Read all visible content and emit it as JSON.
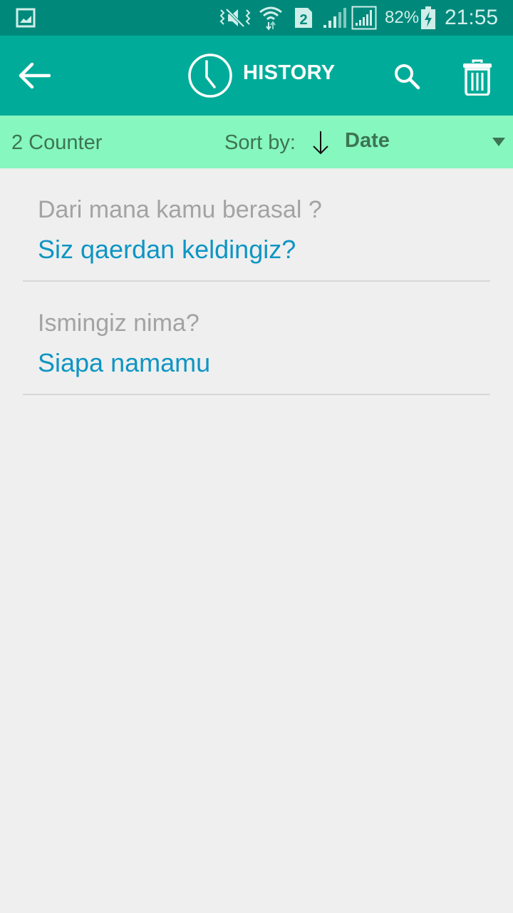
{
  "status_bar": {
    "battery": "82%",
    "time": "21:55",
    "sim_slot": "2",
    "icons": [
      "gallery-notification-icon",
      "vibrate-mute-icon",
      "wifi-icon",
      "sim2-icon",
      "signal-icon",
      "signal-icon",
      "battery-charging-icon"
    ]
  },
  "app_bar": {
    "title": "HISTORY",
    "back_icon": "arrow-left-icon",
    "title_icon": "clock-icon",
    "search_icon": "search-icon",
    "delete_icon": "trash-icon"
  },
  "sort_bar": {
    "counter": "2 Counter",
    "sort_label": "Sort by:",
    "sort_direction_icon": "arrow-down-icon",
    "sort_value": "Date",
    "dropdown_icon": "triangle-down-icon"
  },
  "history": {
    "items": [
      {
        "source": "Dari mana kamu berasal ?",
        "translation": "Siz qaerdan keldingiz?"
      },
      {
        "source": "Ismingiz nima?",
        "translation": "Siapa namamu"
      }
    ]
  },
  "colors": {
    "status_bar": "#00897b",
    "app_bar": "#00ac99",
    "sort_bar": "#86f7be",
    "source_text": "#a3a3a3",
    "translation_text": "#0e95c3"
  }
}
